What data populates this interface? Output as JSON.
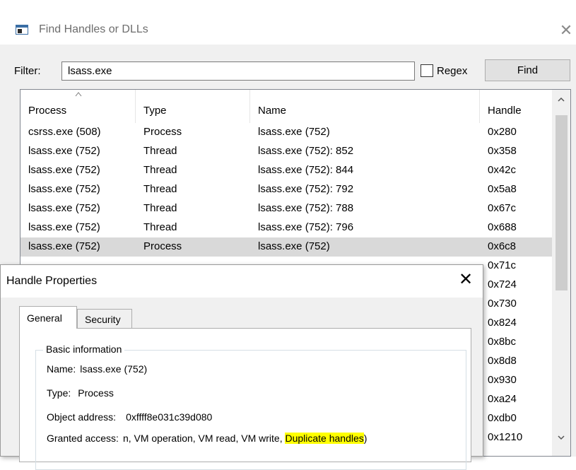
{
  "find_window": {
    "title": "Find Handles or DLLs",
    "filter_label": "Filter:",
    "filter_value": "lsass.exe",
    "regex_label": "Regex",
    "regex_checked": false,
    "find_button": "Find",
    "columns": [
      "Process",
      "Type",
      "Name",
      "Handle"
    ],
    "rows": [
      {
        "process": "csrss.exe (508)",
        "type": "Process",
        "name": "lsass.exe (752)",
        "handle": "0x280"
      },
      {
        "process": "lsass.exe (752)",
        "type": "Thread",
        "name": "lsass.exe (752): 852",
        "handle": "0x358"
      },
      {
        "process": "lsass.exe (752)",
        "type": "Thread",
        "name": "lsass.exe (752): 844",
        "handle": "0x42c"
      },
      {
        "process": "lsass.exe (752)",
        "type": "Thread",
        "name": "lsass.exe (752): 792",
        "handle": "0x5a8"
      },
      {
        "process": "lsass.exe (752)",
        "type": "Thread",
        "name": "lsass.exe (752): 788",
        "handle": "0x67c"
      },
      {
        "process": "lsass.exe (752)",
        "type": "Thread",
        "name": "lsass.exe (752): 796",
        "handle": "0x688"
      },
      {
        "process": "lsass.exe (752)",
        "type": "Process",
        "name": "lsass.exe (752)",
        "handle": "0x6c8"
      },
      {
        "process": "",
        "type": "",
        "name": "",
        "handle": "0x71c"
      },
      {
        "process": "",
        "type": "",
        "name": "",
        "handle": "0x724"
      },
      {
        "process": "",
        "type": "",
        "name": "",
        "handle": "0x730"
      },
      {
        "process": "",
        "type": "",
        "name": "",
        "handle": "0x824"
      },
      {
        "process": "",
        "type": "",
        "name": "",
        "handle": "0x8bc"
      },
      {
        "process": "",
        "type": "",
        "name": "",
        "handle": "0x8d8"
      },
      {
        "process": "",
        "type": "",
        "name": "",
        "handle": "0x930"
      },
      {
        "process": "",
        "type": "",
        "name": "",
        "handle": "0xa24"
      },
      {
        "process": "",
        "type": "",
        "name": "",
        "handle": "0xdb0"
      },
      {
        "process": "",
        "type": "",
        "name": "",
        "handle": "0x1210"
      }
    ],
    "selected_row_index": 6
  },
  "handle_properties": {
    "title": "Handle Properties",
    "tabs": [
      "General",
      "Security"
    ],
    "active_tab": "General",
    "group_title": "Basic information",
    "name_label": "Name:",
    "name_value": "lsass.exe (752)",
    "type_label": "Type:",
    "type_value": "Process",
    "object_address_label": "Object address:",
    "object_address_value": "0xffff8e031c39d080",
    "granted_access_label": "Granted access:",
    "granted_access_value": "n, VM operation, VM read, VM write,",
    "granted_access_highlight": "Duplicate handles",
    "granted_access_tail": ")"
  },
  "colors": {
    "highlight": "#ffff00",
    "selected_row": "#d9d9d9",
    "window_bg": "#f0f0f0"
  }
}
